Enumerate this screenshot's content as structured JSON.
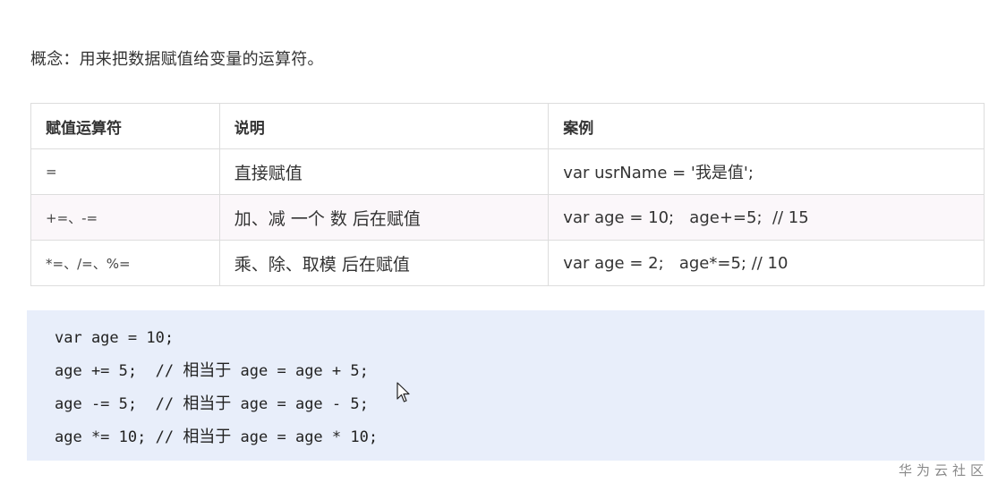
{
  "concept": "概念：用来把数据赋值给变量的运算符。",
  "table": {
    "headers": [
      "赋值运算符",
      "说明",
      "案例"
    ],
    "rows": [
      {
        "op": "=",
        "desc": "直接赋值",
        "example": "var usrName = '我是值';"
      },
      {
        "op": "+=、-=",
        "desc": "加、减 一个 数 后在赋值",
        "example": "var age = 10;   age+=5;  // 15"
      },
      {
        "op": "*=、/=、%=",
        "desc": "乘、除、取模 后在赋值",
        "example": "var age = 2;   age*=5; // 10"
      }
    ]
  },
  "code": {
    "lines": [
      {
        "code": "var age = 10;",
        "comment_prefix": "",
        "comment_zh": "",
        "comment_rest": ""
      },
      {
        "code": "age += 5;  ",
        "comment_prefix": "// ",
        "comment_zh": "相当于",
        "comment_rest": " age = age + 5;"
      },
      {
        "code": "age -= 5;  ",
        "comment_prefix": "// ",
        "comment_zh": "相当于",
        "comment_rest": " age = age - 5;"
      },
      {
        "code": "age *= 10; ",
        "comment_prefix": "// ",
        "comment_zh": "相当于",
        "comment_rest": " age = age * 10;"
      }
    ],
    "background": "#e8eefa"
  },
  "watermark": "华为云社区",
  "icons": {
    "cursor": "mouse-pointer-icon"
  }
}
